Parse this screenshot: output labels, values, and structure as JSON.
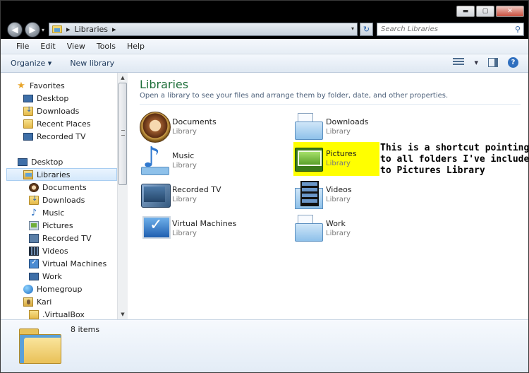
{
  "window": {
    "controls": {
      "minimize": "▬",
      "maximize": "▢",
      "close": "✕"
    }
  },
  "nav": {
    "back_glyph": "◀",
    "forward_glyph": "▶",
    "history_glyph": "▾"
  },
  "address": {
    "separator": "▸",
    "crumb": "Libraries",
    "trail_separator": "▸",
    "dropdown_glyph": "▾",
    "refresh_glyph": "↻"
  },
  "search": {
    "placeholder": "Search Libraries",
    "icon_glyph": "⚲"
  },
  "menu": {
    "items": [
      "File",
      "Edit",
      "View",
      "Tools",
      "Help"
    ]
  },
  "toolbar": {
    "organize": "Organize ▾",
    "new_library": "New library",
    "views_dropdown": "▾",
    "help": "?"
  },
  "sidebar": {
    "favorites": {
      "label": "Favorites",
      "items": [
        "Desktop",
        "Downloads",
        "Recent Places",
        "Recorded TV"
      ]
    },
    "desktop": "Desktop",
    "libraries": {
      "label": "Libraries",
      "items": [
        "Documents",
        "Downloads",
        "Music",
        "Pictures",
        "Recorded TV",
        "Videos",
        "Virtual Machines",
        "Work"
      ]
    },
    "homegroup": "Homegroup",
    "user": "Kari",
    "user_items": [
      ".VirtualBox"
    ],
    "scroll_up": "▲",
    "scroll_down": "▼"
  },
  "content": {
    "title": "Libraries",
    "subtitle": "Open a library to see your files and arrange them by folder, date, and other properties.",
    "libraries": [
      {
        "name": "Documents",
        "type": "Library",
        "icon": "documents-library-icon"
      },
      {
        "name": "Downloads",
        "type": "Library",
        "icon": "downloads-library-icon"
      },
      {
        "name": "Music",
        "type": "Library",
        "icon": "music-library-icon"
      },
      {
        "name": "Pictures",
        "type": "Library",
        "icon": "pictures-library-icon"
      },
      {
        "name": "Recorded TV",
        "type": "Library",
        "icon": "recorded-tv-library-icon"
      },
      {
        "name": "Videos",
        "type": "Library",
        "icon": "videos-library-icon"
      },
      {
        "name": "Virtual Machines",
        "type": "Library",
        "icon": "virtual-machines-library-icon"
      },
      {
        "name": "Work",
        "type": "Library",
        "icon": "work-library-icon"
      }
    ],
    "annotation": "This is a shortcut pointing\nto all folders I've included\nto Pictures Library",
    "highlight_color": "#ffff00"
  },
  "details": {
    "count": "8 items"
  },
  "colors": {
    "title_green": "#1e6f3a",
    "toolbar_text": "#1e395b",
    "selection": "#d4e8fb"
  }
}
